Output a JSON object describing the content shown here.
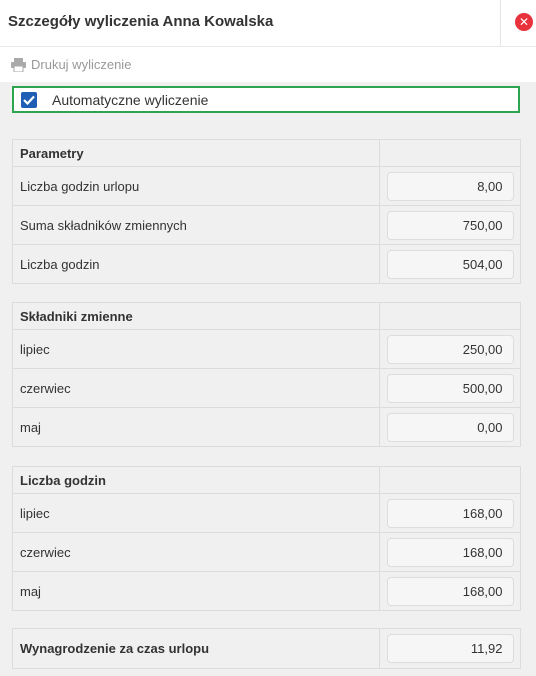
{
  "header": {
    "title": "Szczegóły wyliczenia Anna Kowalska",
    "close_icon": "close-icon",
    "close_color": "#e8323c"
  },
  "toolbar": {
    "print_label": "Drukuj wyliczenie",
    "print_icon": "printer-icon"
  },
  "auto_calc": {
    "label": "Automatyczne wyliczenie",
    "checked": true,
    "highlight_color": "#2ea44f",
    "checkbox_color": "#1e5fb5"
  },
  "sections": {
    "parametry": {
      "title": "Parametry",
      "rows": [
        {
          "label": "Liczba godzin urlopu",
          "value": "8,00"
        },
        {
          "label": "Suma składników zmiennych",
          "value": "750,00"
        },
        {
          "label": "Liczba godzin",
          "value": "504,00"
        }
      ]
    },
    "skladniki": {
      "title": "Składniki zmienne",
      "rows": [
        {
          "label": "lipiec",
          "value": "250,00"
        },
        {
          "label": "czerwiec",
          "value": "500,00"
        },
        {
          "label": "maj",
          "value": "0,00"
        }
      ]
    },
    "godziny": {
      "title": "Liczba godzin",
      "rows": [
        {
          "label": "lipiec",
          "value": "168,00"
        },
        {
          "label": "czerwiec",
          "value": "168,00"
        },
        {
          "label": "maj",
          "value": "168,00"
        }
      ]
    },
    "wynik": {
      "label": "Wynagrodzenie za czas urlopu",
      "value": "11,92"
    }
  }
}
